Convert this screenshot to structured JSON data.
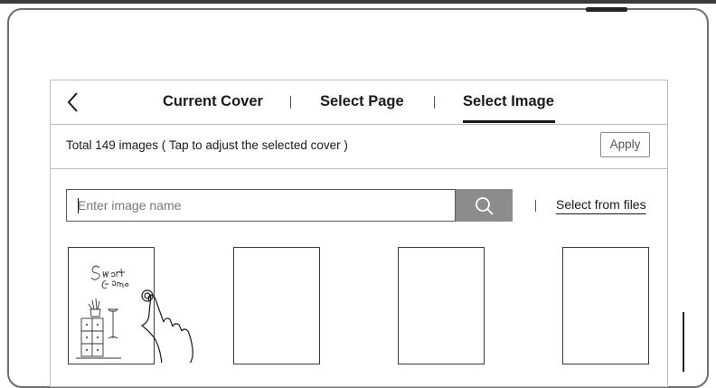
{
  "header": {
    "back_icon": "chevron-left-icon",
    "tabs": [
      {
        "label": "Current Cover",
        "selected": false
      },
      {
        "label": "Select Page",
        "selected": false
      },
      {
        "label": "Select Image",
        "selected": true
      }
    ]
  },
  "info": {
    "text": "Total 149 images ( Tap to adjust the selected cover )",
    "apply_label": "Apply"
  },
  "search": {
    "placeholder": "Enter image name",
    "value": "",
    "button_icon": "search-icon",
    "select_files_label": "Select from files"
  },
  "gallery": {
    "thumbnails": [
      {
        "index": 1,
        "content": "Smart Home sketch",
        "selected": false
      },
      {
        "index": 2,
        "content": "",
        "selected": false
      },
      {
        "index": 3,
        "content": "",
        "selected": false
      },
      {
        "index": 4,
        "content": "",
        "selected": false
      }
    ],
    "gesture_icon": "tap-hand-icon"
  },
  "colors": {
    "accent": "#1a1a1a",
    "border": "#bdbdbd",
    "search_button": "#8c8c8c"
  }
}
